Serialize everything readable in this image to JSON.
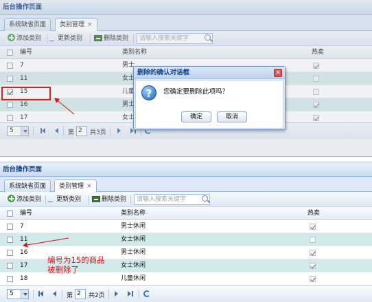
{
  "top": {
    "title": "后台操作页面",
    "tabs": [
      {
        "label": "系统缺省页面"
      },
      {
        "label": "类别管理",
        "close": "×"
      }
    ],
    "toolbar": {
      "add": "添加类别",
      "edit": "更新类别",
      "delete": "删除类别",
      "search_placeholder": "请输入搜索关键字"
    },
    "columns": {
      "id": "编号",
      "name": "类别名称",
      "hot": "热卖"
    },
    "rows": [
      {
        "id": "7",
        "name": "男士",
        "hot": true,
        "checked": false
      },
      {
        "id": "11",
        "name": "女士",
        "hot": false,
        "checked": false
      },
      {
        "id": "15",
        "name": "儿童",
        "hot": false,
        "checked": true
      },
      {
        "id": "16",
        "name": "男士",
        "hot": true,
        "checked": false
      },
      {
        "id": "17",
        "name": "女士",
        "hot": true,
        "checked": false
      }
    ],
    "pager": {
      "page_size": "5",
      "page_prefix": "第",
      "page": "2",
      "total": "共3页"
    }
  },
  "dialog": {
    "title": "删除的确认对话框",
    "close": "✕",
    "icon": "question-icon",
    "message": "您确定要删除此项吗？",
    "ok": "确定",
    "cancel": "取消"
  },
  "bottom": {
    "title": "后台操作页面",
    "tabs": [
      {
        "label": "系统缺省页面"
      },
      {
        "label": "类别管理",
        "close": "×"
      }
    ],
    "toolbar": {
      "add": "添加类别",
      "edit": "更新类别",
      "delete": "删除类别",
      "search_placeholder": "请输入搜索关键字"
    },
    "columns": {
      "id": "编号",
      "name": "类别名称",
      "hot": "热卖"
    },
    "rows": [
      {
        "id": "7",
        "name": "男士休闲",
        "hot": true,
        "checked": false
      },
      {
        "id": "11",
        "name": "女士休闲",
        "hot": false,
        "checked": false
      },
      {
        "id": "16",
        "name": "男士休闲",
        "hot": true,
        "checked": false
      },
      {
        "id": "17",
        "name": "女士休闲",
        "hot": true,
        "checked": false
      },
      {
        "id": "18",
        "name": "儿童休闲",
        "hot": true,
        "checked": false
      }
    ],
    "pager": {
      "page_size": "5",
      "page_prefix": "第",
      "page": "2",
      "total": "共2页"
    }
  },
  "annotation": {
    "note_line1": "编号为15的商品",
    "note_line2": "被删除了",
    "color": "#e01010"
  }
}
